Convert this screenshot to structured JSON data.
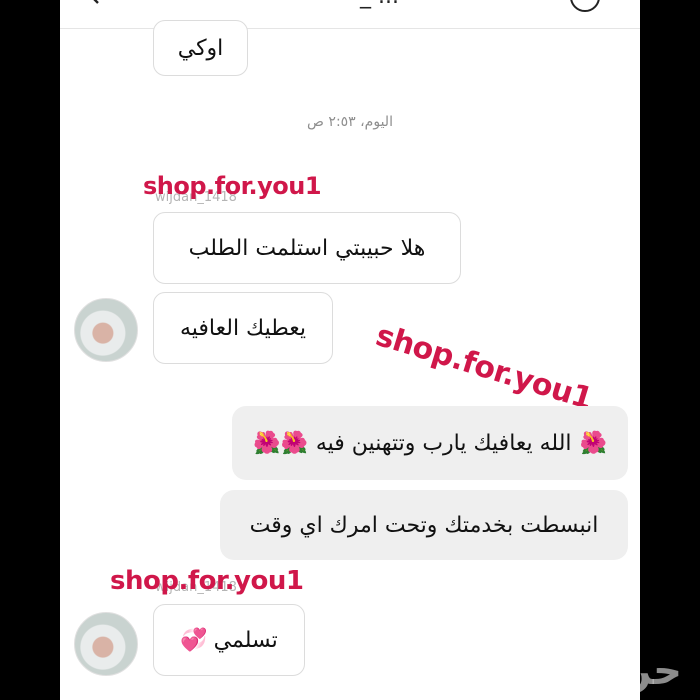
{
  "header": {
    "title": "_ ..."
  },
  "conversation": {
    "timestamp": "اليوم، ٢:٥٣ ص",
    "messages": [
      {
        "text": "اوكي"
      },
      {
        "sender": "wijdan_1418",
        "text": "هلا حبيبتي استلمت الطلب"
      },
      {
        "text": "يعطيك العافيه"
      },
      {
        "text": "الله يعافيك يارب وتتهنين فيه",
        "emoji_left": "🌺🌺",
        "emoji_right": "🌺"
      },
      {
        "text": "انبسطت بخدمتك وتحت امرك اي وقت"
      },
      {
        "sender": "wijdan_1418",
        "text": "تسلمي",
        "emoji": "💞"
      }
    ]
  },
  "watermarks": [
    "shop.for.you1",
    "shop.for.you1",
    "shop.for.you1"
  ],
  "site_logo": "حراج",
  "colors": {
    "watermark": "#d0174a",
    "incoming_bubble_border": "#dcdcdc",
    "outgoing_bubble_bg": "#efefef",
    "timestamp": "#8e8e8e"
  }
}
